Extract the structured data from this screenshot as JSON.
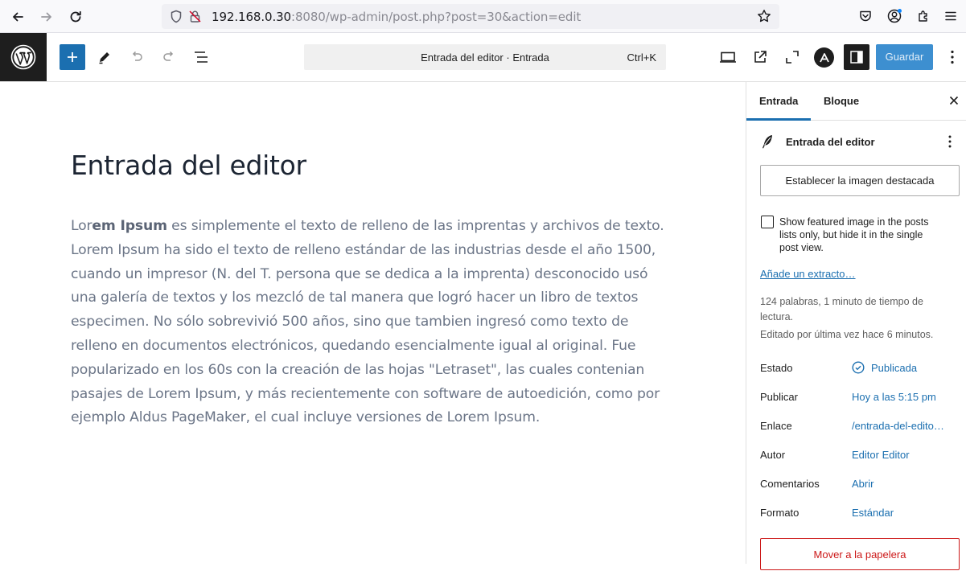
{
  "browser": {
    "url_host": "192.168.0.30",
    "url_rest": ":8080/wp-admin/post.php?post=30&action=edit"
  },
  "toolbar": {
    "command_title": "Entrada del editor · Entrada",
    "command_shortcut": "Ctrl+K",
    "save_label": "Guardar"
  },
  "post": {
    "title": "Entrada del editor",
    "body_lead_plain": "Lor",
    "body_lead_bold": "em Ipsum",
    "body_rest": " es simplemente el texto de relleno de las imprentas y archivos de texto. Lorem Ipsum ha sido el texto de relleno estándar de las industrias desde el año 1500, cuando un impresor (N. del T. persona que se dedica a la imprenta) desconocido usó una galería de textos y los mezcló de tal manera que logró hacer un libro de textos especimen. No sólo sobrevivió 500 años, sino que tambien ingresó como texto de relleno en documentos electrónicos, quedando esencialmente igual al original. Fue popularizado en los 60s con la creación de las hojas \"Letraset\", las cuales contenian pasajes de Lorem Ipsum, y más recientemente con software de autoedición, como por ejemplo Aldus PageMaker, el cual incluye versiones de Lorem Ipsum."
  },
  "sidebar": {
    "tabs": [
      {
        "label": "Entrada",
        "active": true
      },
      {
        "label": "Bloque",
        "active": false
      }
    ],
    "post_title": "Entrada del editor",
    "featured_button": "Establecer la imagen destacada",
    "featured_checkbox_label": "Show featured image in the posts lists only, but hide it in the single post view.",
    "featured_checkbox_checked": false,
    "excerpt_link": "Añade un extracto…",
    "word_count": "124 palabras, 1 minuto de tiempo de lectura.",
    "last_edited": "Editado por última vez hace 6 minutos.",
    "rows": [
      {
        "label": "Estado",
        "value": "Publicada"
      },
      {
        "label": "Publicar",
        "value": "Hoy a las 5:15 pm"
      },
      {
        "label": "Enlace",
        "value": "/entrada-del-edito…"
      },
      {
        "label": "Autor",
        "value": "Editor Editor"
      },
      {
        "label": "Comentarios",
        "value": "Abrir"
      },
      {
        "label": "Formato",
        "value": "Estándar"
      }
    ],
    "trash_button": "Mover a la papelera"
  },
  "colors": {
    "accent": "#1b6fb0",
    "danger": "#cc1818",
    "dark": "#1e1e1e"
  }
}
